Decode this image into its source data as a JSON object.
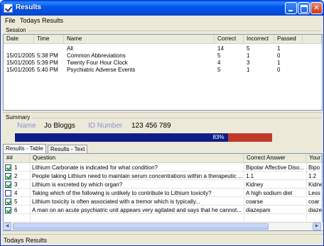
{
  "window": {
    "title": "Results",
    "minimize": "",
    "maximize": "",
    "close": "✕"
  },
  "menu": {
    "file": "File",
    "todays_results": "Todays Results"
  },
  "session": {
    "label": "Session",
    "columns": [
      "Date",
      "Time",
      "Name",
      "Correct",
      "Incorrect",
      "Passed"
    ],
    "rows": [
      {
        "date": "",
        "time": "",
        "name": "All",
        "correct": "14",
        "incorrect": "5",
        "passed": "1"
      },
      {
        "date": "15/01/2005",
        "time": "5:38 PM",
        "name": "Common Abbreviations",
        "correct": "5",
        "incorrect": "1",
        "passed": "0"
      },
      {
        "date": "15/01/2005",
        "time": "5:39 PM",
        "name": "Twenty Four Hour Clock",
        "correct": "4",
        "incorrect": "3",
        "passed": "1"
      },
      {
        "date": "15/01/2005",
        "time": "5:40 PM",
        "name": "Psychiatric Adverse Events",
        "correct": "5",
        "incorrect": "1",
        "passed": "0"
      }
    ]
  },
  "summary": {
    "label": "Summary",
    "name_label": "Name",
    "name_value": "Jo Bloggs",
    "id_label": "ID Number",
    "id_value": "123 456 789",
    "progress_percent": 83,
    "progress_text": "83%",
    "colors": {
      "fill": "#0f1e86",
      "remainder": "#c0392b",
      "label": "#8c8fd8"
    }
  },
  "tabs": {
    "table": "Results - Table",
    "text": "Results - Text"
  },
  "results": {
    "columns": [
      "##",
      "Question",
      "Correct Answer",
      "Your"
    ],
    "rows": [
      {
        "checked": true,
        "num": "1",
        "question": "Lithium Carbonate is indicated for what condition?",
        "answer": "Bipolar Affective Diso...",
        "yours": "Bipo"
      },
      {
        "checked": true,
        "num": "2",
        "question": "People taking Lithium need to maintain serum concentrations within a therapeutic ...",
        "answer": "1.1",
        "yours": "1.2"
      },
      {
        "checked": true,
        "num": "3",
        "question": "Lithium is excreted by which organ?",
        "answer": "Kidney",
        "yours": "Kidne"
      },
      {
        "checked": false,
        "num": "4",
        "question": "Taking which of the following is unlikely to contribute to Lithium toxicity?",
        "answer": "A high sodium diet",
        "yours": "Less"
      },
      {
        "checked": true,
        "num": "5",
        "question": "Lithium toxicity is often associated with a tremor which is typically...",
        "answer": "coarse",
        "yours": "coar"
      },
      {
        "checked": true,
        "num": "6",
        "question": "A man on an acute psychiatric unit appears very agitated and says that he cannot...",
        "answer": "diazepam",
        "yours": "diaze"
      }
    ]
  },
  "status": {
    "text": "Todays Results"
  }
}
